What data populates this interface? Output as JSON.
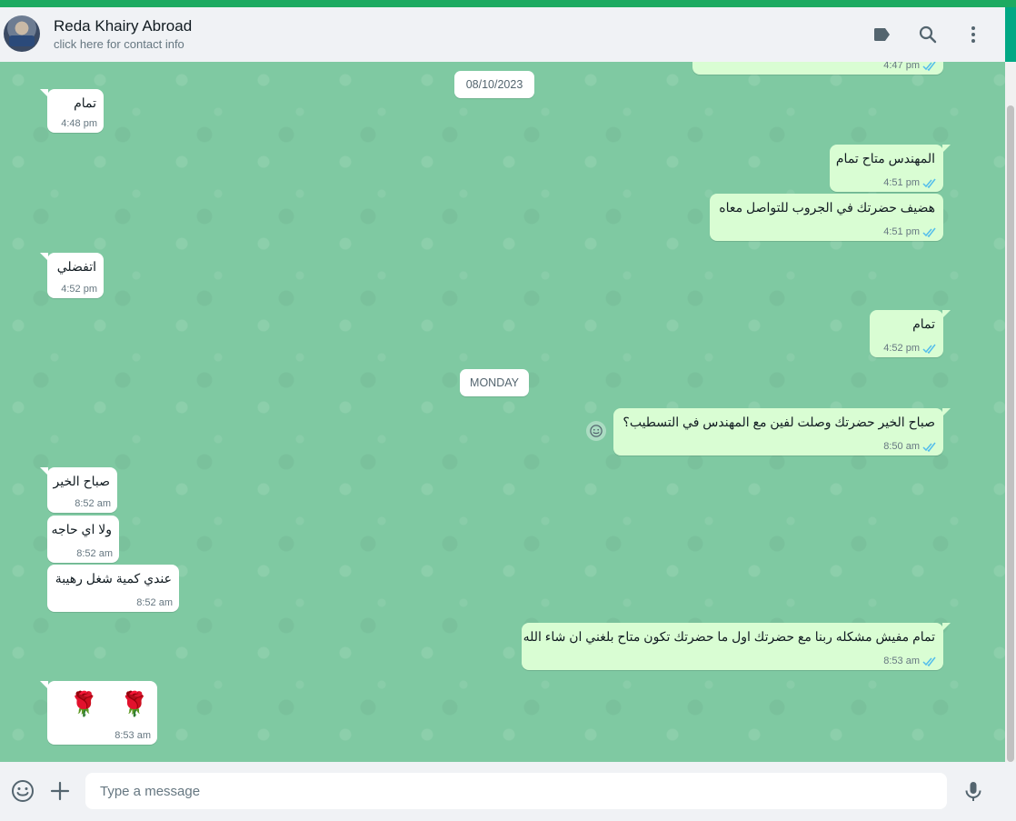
{
  "header": {
    "contact_name": "Reda Khairy Abroad",
    "contact_sub": "click here for contact info"
  },
  "colors": {
    "accent": "#00a884",
    "outgoing_bubble": "#d9fdd3",
    "incoming_bubble": "#ffffff",
    "wallpaper": "#7fc9a2",
    "read_tick": "#53bdeb"
  },
  "icons": {
    "label": "label-icon",
    "search": "search-icon",
    "menu": "menu-icon",
    "emoji": "emoji-icon",
    "attach": "plus-icon",
    "mic": "mic-icon"
  },
  "chat": {
    "partial_top_time": "4:47 pm",
    "dates": [
      "08/10/2023",
      "MONDAY"
    ],
    "messages": [
      {
        "dir": "in",
        "text": "تمام",
        "time": "4:48 pm"
      },
      {
        "dir": "out",
        "text": "المهندس متاح تمام",
        "time": "4:51 pm"
      },
      {
        "dir": "out",
        "text": "هضيف حضرتك في الجروب للتواصل معاه",
        "time": "4:51 pm"
      },
      {
        "dir": "in",
        "text": "اتفضلي",
        "time": "4:52 pm"
      },
      {
        "dir": "out",
        "text": "تمام",
        "time": "4:52 pm"
      },
      {
        "dir": "out",
        "text": "صباح الخير حضرتك وصلت لفين مع المهندس في التسطيب؟",
        "time": "8:50 am"
      },
      {
        "dir": "in",
        "text": "صباح الخير",
        "time": "8:52 am"
      },
      {
        "dir": "in",
        "text": "ولا اي حاجه",
        "time": "8:52 am"
      },
      {
        "dir": "in",
        "text": "عندي كمية شغل رهيبة",
        "time": "8:52 am"
      },
      {
        "dir": "out",
        "text": "تمام مفيش مشكله ربنا مع حضرتك اول ما حضرتك تكون متاح بلغني ان شاء الله",
        "time": "8:53 am"
      },
      {
        "dir": "in",
        "text": "🌹 🌹",
        "time": "8:53 am"
      }
    ]
  },
  "composer": {
    "placeholder": "Type a message"
  }
}
